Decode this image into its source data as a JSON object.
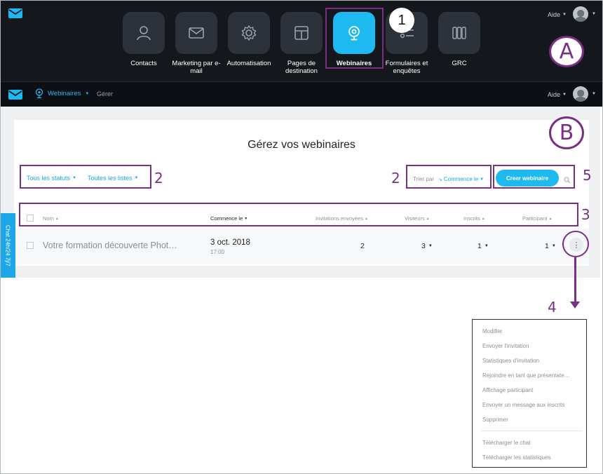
{
  "top_bar": {
    "help_label": "Aide",
    "apps": [
      {
        "label": "Contacts",
        "icon": "person-icon"
      },
      {
        "label": "Marketing par e-mail",
        "icon": "envelope-icon"
      },
      {
        "label": "Automatisation",
        "icon": "gear-icon"
      },
      {
        "label": "Pages de destination",
        "icon": "layout-icon"
      },
      {
        "label": "Webinaires",
        "icon": "webcam-icon",
        "active": true
      },
      {
        "label": "Formulaires et enquêtes",
        "icon": "form-icon"
      },
      {
        "label": "GRC",
        "icon": "columns-icon"
      }
    ]
  },
  "sub_nav": {
    "section_label": "Webinaires",
    "manage_label": "Gérer",
    "help_label": "Aide"
  },
  "page": {
    "title": "Gérez vos webinaires",
    "filters": {
      "status": "Tous les statuts",
      "lists": "Toutes les listes"
    },
    "sort": {
      "label": "Trier par",
      "value": "Commence le"
    },
    "create_button": "Creer webinaire"
  },
  "table": {
    "headers": {
      "name": "Nom",
      "starts": "Commence le",
      "invitations": "Invitations envoyées",
      "visitors": "Visiteurs",
      "registered": "Inscrits",
      "participant": "Participant"
    },
    "rows": [
      {
        "name": "Votre formation découverte Phot…",
        "date": "3 oct. 2018",
        "time": "17:00",
        "invitations": "2",
        "visitors": "3",
        "registered": "1",
        "participant": "1"
      }
    ]
  },
  "chat_tab": "Chat 24h/24 7j/7",
  "row_menu": {
    "items": [
      "Modifier",
      "Envoyer l'invitation",
      "Statistiques d'invitation",
      "Rejoindre en tant que présentate…",
      "Affichage participant",
      "Envoyer un message aux inscrits",
      "Supprimer",
      "Télécharger le chat",
      "Télécharger les statistiques"
    ]
  },
  "annotations": {
    "badge_1": "1",
    "label_A": "A",
    "label_B": "B",
    "num_2a": "2",
    "num_2b": "2",
    "num_3": "3",
    "num_4": "4",
    "num_5": "5"
  },
  "colors": {
    "accent": "#1fb9f2",
    "annotation": "#7a2e86",
    "top_bg": "#14171c"
  }
}
